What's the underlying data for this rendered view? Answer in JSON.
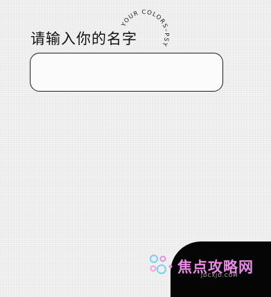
{
  "form": {
    "prompt_label": "请输入你的名字",
    "name_value": "",
    "badge_text": "YOUR COLORS–PSY"
  },
  "watermark": {
    "text": "焦点攻略网",
    "sub_text": "JDCXJD.COM",
    "colors": [
      "#7fd3f2",
      "#e98be8",
      "#f4a3d8"
    ]
  }
}
